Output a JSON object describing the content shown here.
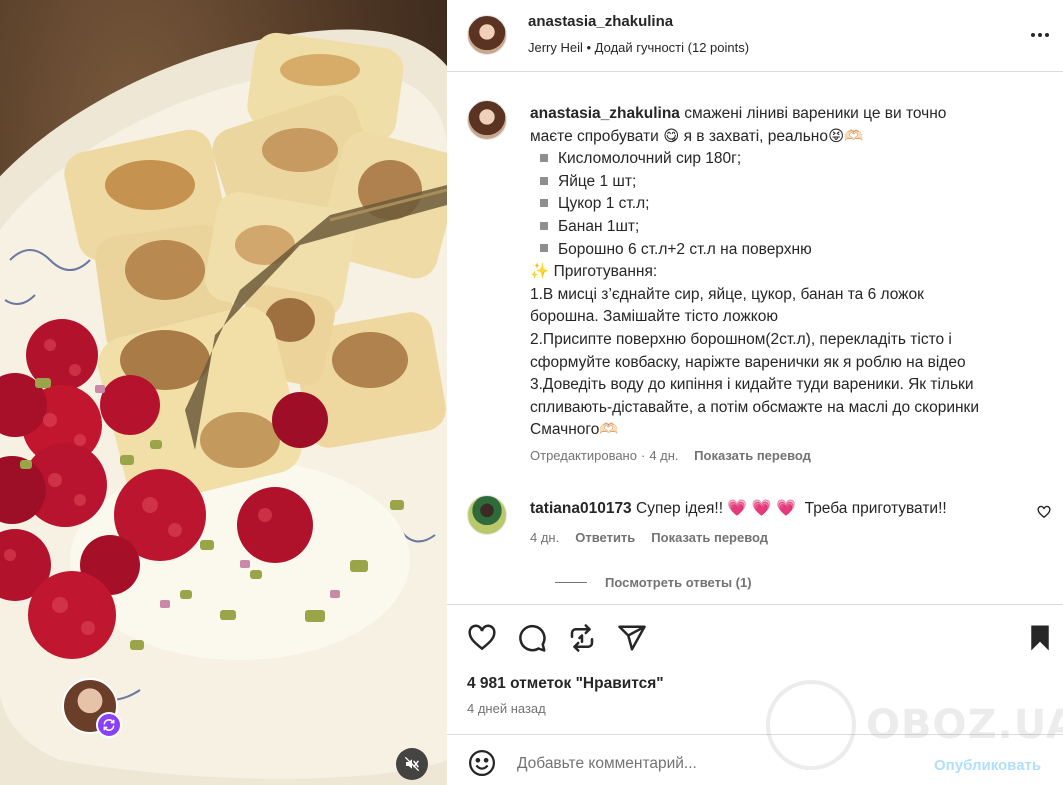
{
  "post": {
    "author": "anastasia_zhakulina",
    "audio": "Jerry Heil • Додай гучності (12 points)"
  },
  "caption": {
    "username": "anastasia_zhakulina",
    "lines": [
      "смажені ліниві вареники це ви точно",
      "маєте спробувати 😋 я в захваті, реально😝🫶🏻"
    ],
    "ingredients": [
      "Кисломолочний сир 180г;",
      "Яйце 1 шт;",
      "Цукор 1 ст.л;",
      "Банан 1шт;",
      "Борошно 6 ст.л+2 ст.л на поверхню"
    ],
    "steps_title": "✨ Приготування:",
    "steps": [
      "1.В мисці з’єднайте сир, яйце, цукор, банан та 6 ложок",
      "борошна. Замішайте тісто ложкою",
      "2.Присипте поверхню борошном(2ст.л), перекладіть тісто і",
      "сформуйте ковбаску, наріжте варенички як я роблю на відео",
      "3.Доведіть воду до кипіння і кидайте туди вареники. Як тільки",
      "спливають-діставайте, а потім обсмажте на маслі до скоринки",
      "Смачного🫶🏻"
    ],
    "edited": "Отредактировано",
    "time": "4 дн.",
    "translate": "Показать перевод"
  },
  "comment": {
    "username": "tatiana010173",
    "text": "Супер ідея!!",
    "hearts": "💗 💗 💗",
    "text2": "Треба приготувати!!",
    "time": "4 дн.",
    "reply": "Ответить",
    "translate": "Показать перевод",
    "view_replies": "Посмотреть ответы (1)"
  },
  "footer": {
    "likes": "4 981 отметок \"Нравится\"",
    "time_ago": "4 дней назад",
    "comment_placeholder": "Добавьте комментарий...",
    "post_button": "Опубликовать"
  },
  "watermark": {
    "text": "OBOZ.UA"
  },
  "icons": {
    "like": "heart-icon",
    "comment": "comment-icon",
    "repost": "repost-icon",
    "share": "share-icon",
    "save": "bookmark-icon",
    "emoji": "emoji-icon",
    "mute": "speaker-muted-icon",
    "more": "more-options-icon"
  },
  "colors": {
    "post_button": "#b2dffc",
    "muted_text": "#737373",
    "hearts": "#e8245f",
    "tag_badge": "#8a3ffc"
  }
}
